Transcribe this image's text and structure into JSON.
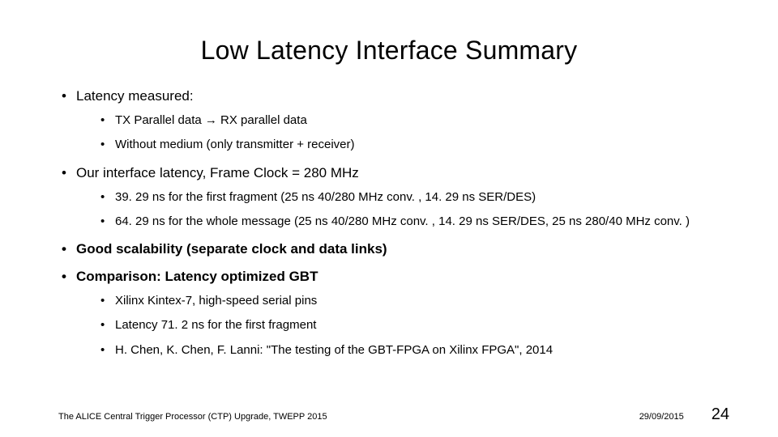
{
  "title": "Low Latency Interface Summary",
  "bullets": {
    "b1": {
      "text": "Latency measured:",
      "sub": {
        "s1": "TX Parallel data → RX parallel data",
        "s2": "Without medium (only transmitter + receiver)"
      }
    },
    "b2": {
      "text": "Our interface latency, Frame Clock = 280 MHz",
      "sub": {
        "s1": "39. 29 ns for the first fragment (25 ns 40/280 MHz conv. , 14. 29 ns SER/DES)",
        "s2": "64. 29 ns for the whole message (25 ns 40/280 MHz conv. , 14. 29 ns SER/DES, 25 ns 280/40 MHz conv. )"
      }
    },
    "b3": {
      "text": "Good scalability (separate clock and data links)"
    },
    "b4": {
      "text": "Comparison: Latency optimized GBT",
      "sub": {
        "s1": "Xilinx Kintex-7, high-speed serial pins",
        "s2": "Latency 71. 2 ns for the first fragment",
        "s3": "H. Chen, K. Chen, F. Lanni: \"The testing of the GBT-FPGA on Xilinx FPGA\", 2014"
      }
    }
  },
  "footer": {
    "left": "The ALICE Central Trigger Processor (CTP) Upgrade, TWEPP 2015",
    "date": "29/09/2015",
    "page": "24"
  }
}
